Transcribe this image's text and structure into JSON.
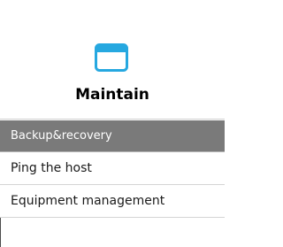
{
  "colors": {
    "icon_accent": "#26a8e0",
    "active_bg": "#7a7a7a",
    "active_text": "#ffffff",
    "separator": "#d4d4d4"
  },
  "header": {
    "icon": "window-icon",
    "title": "Maintain"
  },
  "menu": {
    "items": [
      {
        "label": "Backup&recovery",
        "active": true
      },
      {
        "label": "Ping the host",
        "active": false
      },
      {
        "label": "Equipment management",
        "active": false
      }
    ]
  }
}
